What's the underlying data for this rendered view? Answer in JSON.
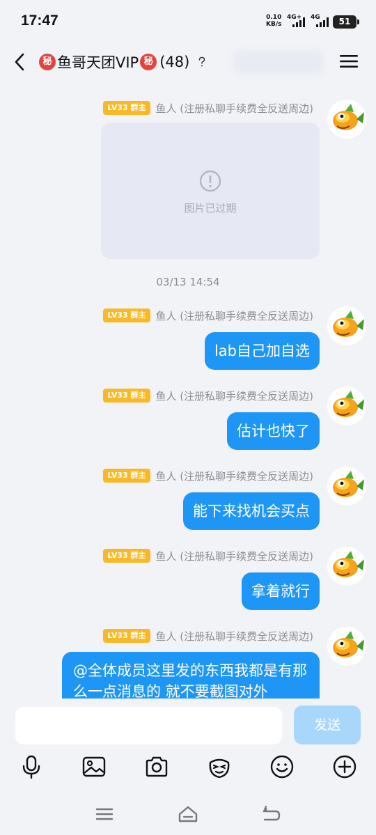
{
  "status_bar": {
    "time": "17:47",
    "net_speed_value": "0.10",
    "net_speed_unit": "KB/s",
    "sim1_label": "4G+",
    "sim2_label": "4G",
    "battery": "51"
  },
  "header": {
    "title": "鱼哥天团VIP",
    "secret_mark": "秘",
    "member_count": "(48)",
    "icons": {
      "back": "back-arrow-icon",
      "help": "help-icon",
      "menu": "menu-icon"
    }
  },
  "messages": [
    {
      "badge": "LV33 群主",
      "sender": "鱼人 (注册私聊手续费全反送周边)",
      "type": "image",
      "image_status": "图片已过期"
    },
    {
      "badge": "LV33 群主",
      "sender": "鱼人 (注册私聊手续费全反送周边)",
      "type": "text",
      "text": "lab自己加自选"
    },
    {
      "badge": "LV33 群主",
      "sender": "鱼人 (注册私聊手续费全反送周边)",
      "type": "text",
      "text": "估计也快了"
    },
    {
      "badge": "LV33 群主",
      "sender": "鱼人 (注册私聊手续费全反送周边)",
      "type": "text",
      "text": "能下来找机会买点"
    },
    {
      "badge": "LV33 群主",
      "sender": "鱼人 (注册私聊手续费全反送周边)",
      "type": "text",
      "text": "拿着就行"
    },
    {
      "badge": "LV33 群主",
      "sender": "鱼人 (注册私聊手续费全反送周边)",
      "type": "text",
      "text": "@全体成员这里发的东西我都是有那么一点消息的  就不要截图对外"
    }
  ],
  "timestamp": "03/13 14:54",
  "composer": {
    "input_value": "",
    "send_label": "发送"
  },
  "toolbar_icons": [
    "microphone-icon",
    "image-icon",
    "camera-icon",
    "sticker-icon",
    "emoji-icon",
    "plus-icon"
  ],
  "colors": {
    "bubble": "#1e96f6",
    "badge": "#f7b928",
    "send_disabled": "#a9d7fb",
    "background": "#f2f3f7"
  }
}
